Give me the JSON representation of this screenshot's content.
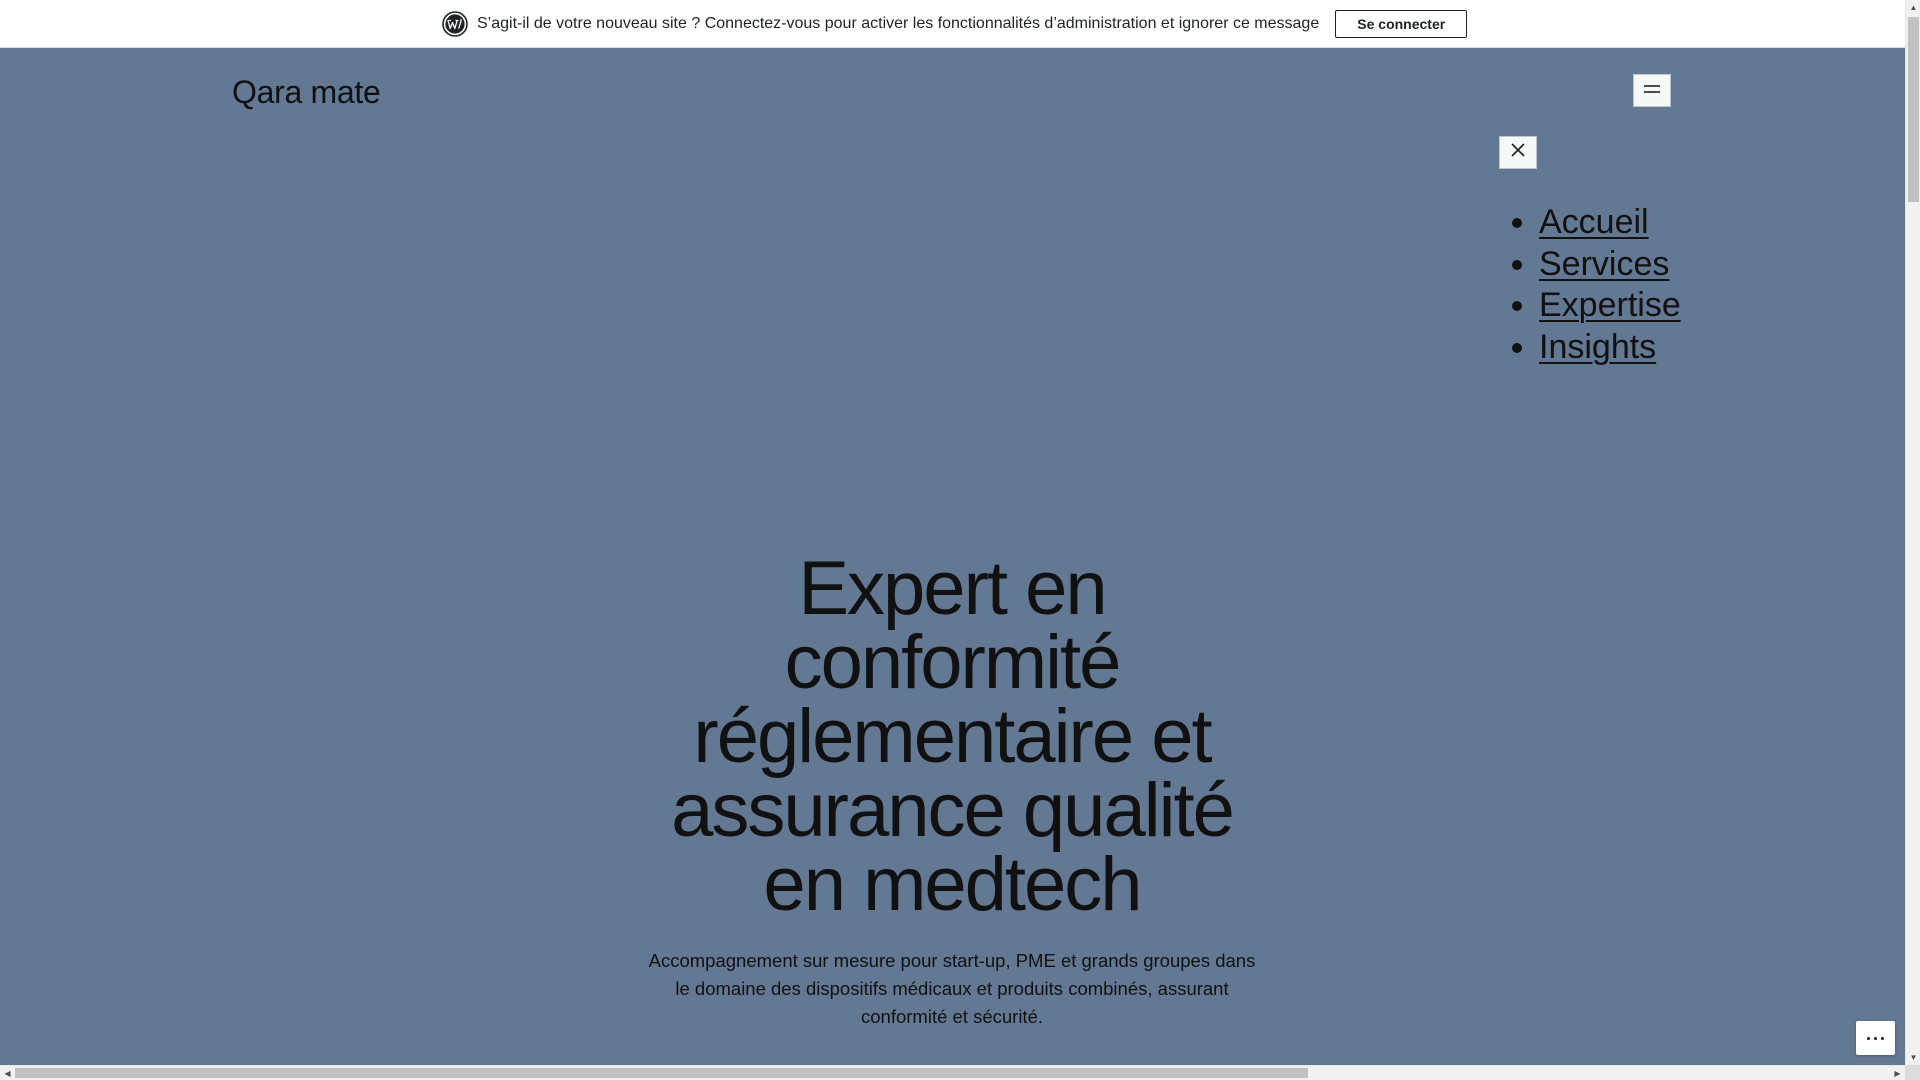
{
  "notice": {
    "text": "S’agit-il de votre nouveau site ? Connectez-vous pour activer les fonctionnalités d’administration et ignorer ce message",
    "button_label": "Se connecter",
    "logo_icon": "wordpress-icon"
  },
  "site": {
    "title": "Qara mate"
  },
  "nav": {
    "open_icon": "hamburger-menu-icon",
    "close_icon": "close-icon",
    "items": [
      {
        "label": "Accueil"
      },
      {
        "label": "Services"
      },
      {
        "label": "Expertise"
      },
      {
        "label": "Insights"
      }
    ]
  },
  "hero": {
    "heading": "Expert en conformité réglementaire et assurance qualité en medtech",
    "subheading": "Accompagnement sur mesure pour start-up, PME et grands groupes dans le domaine des dispositifs médicaux et produits combinés, assurant conformité et sécurité."
  },
  "floating": {
    "more_icon": "more-options-icon"
  },
  "colors": {
    "background": "#637893",
    "text": "#111111",
    "notice_bg": "#ffffff"
  }
}
